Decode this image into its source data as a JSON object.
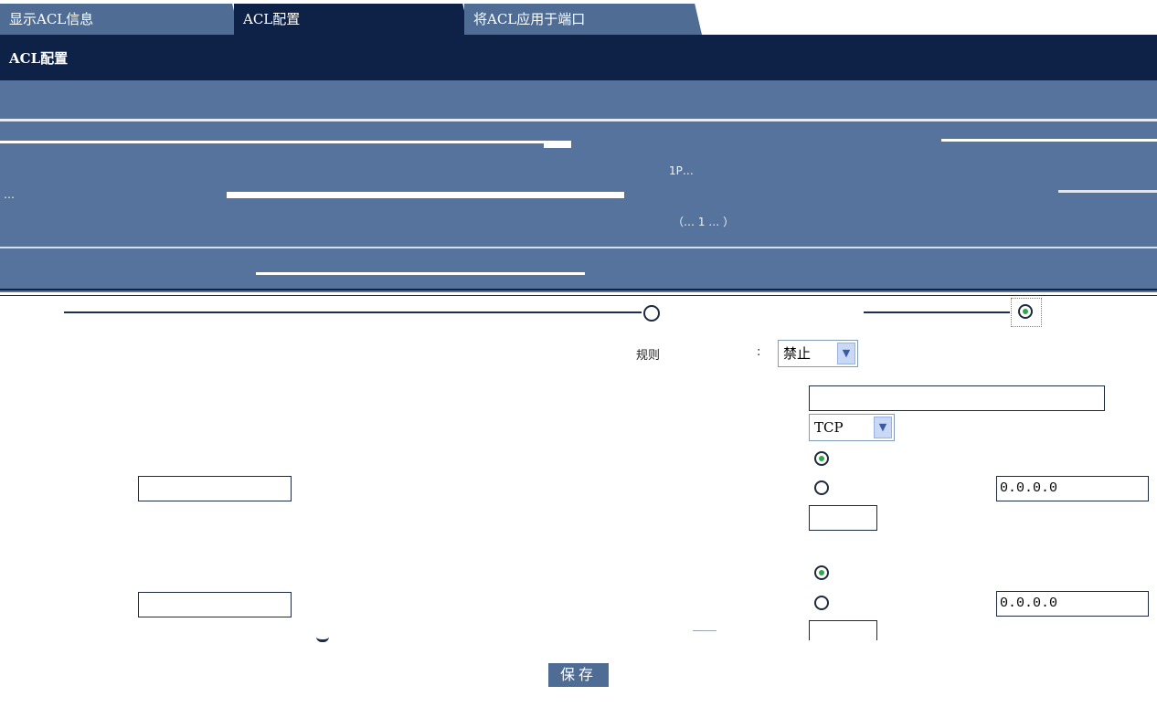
{
  "tabs": [
    {
      "label": "显示ACL信息"
    },
    {
      "label": "ACL配置"
    },
    {
      "label": "将ACL应用于端口"
    }
  ],
  "section": {
    "title": "ACL配置"
  },
  "info": {
    "line_b_right": "1P…",
    "line_c_left": "…",
    "line_d_right": "（… 1 … ）"
  },
  "rule": {
    "label": "规则",
    "colon": ":",
    "action_value": "禁止"
  },
  "protocol": {
    "value": "TCP"
  },
  "source_ip": {
    "value": "0.0.0.0"
  },
  "dest_ip": {
    "value": "0.0.0.0"
  },
  "save": {
    "label": "保存"
  }
}
